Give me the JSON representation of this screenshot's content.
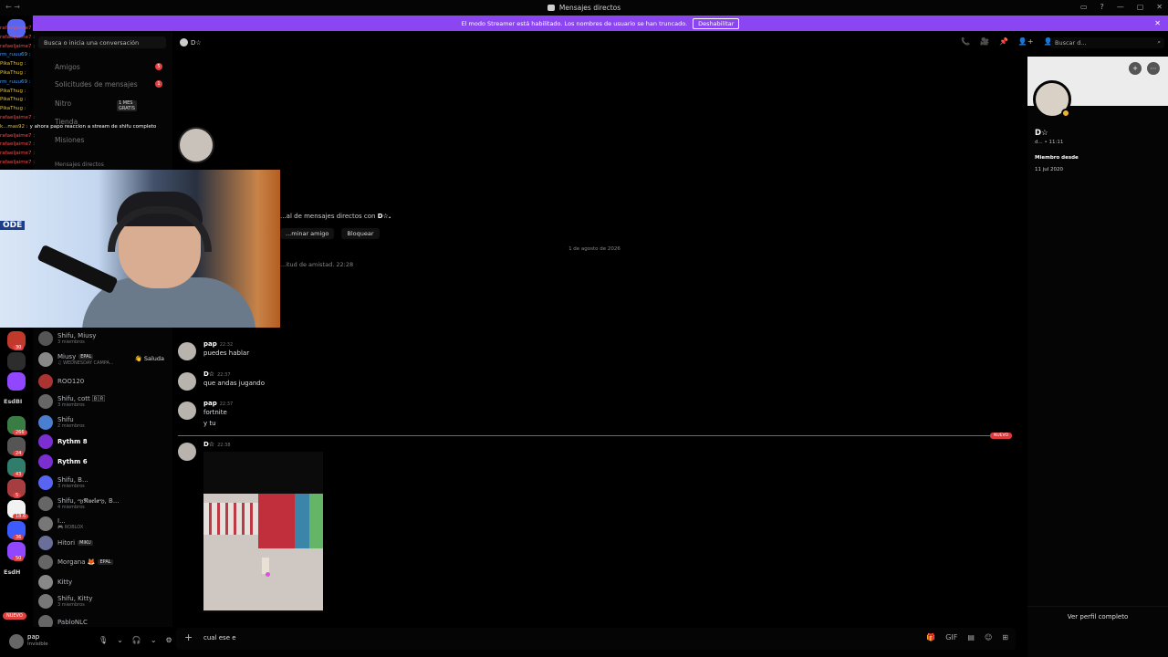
{
  "titlebar": {
    "title": "Mensajes directos",
    "nav": "← →",
    "controls": [
      "▭",
      "?",
      "—",
      "▢",
      "✕"
    ]
  },
  "banner": {
    "text": "El modo Streamer está habilitado. Los nombres de usuario se han truncado.",
    "button": "Deshabilitar",
    "close": "✕"
  },
  "rail": {
    "items": [
      {
        "label": "",
        "color": "#5865f2",
        "badge": ""
      },
      {
        "label": "",
        "color": "#c0392b",
        "badge": "30"
      },
      {
        "label": "",
        "color": "#2d2d2d",
        "badge": ""
      },
      {
        "label": "",
        "color": "#9146ff",
        "badge": ""
      },
      {
        "label": "EsdBI",
        "color": "",
        "badge": ""
      },
      {
        "label": "",
        "color": "#3a7d44",
        "badge": "266"
      },
      {
        "label": "",
        "color": "#555",
        "badge": "24"
      },
      {
        "label": "",
        "color": "#2f7d6a",
        "badge": "43"
      },
      {
        "label": "",
        "color": "#a63d40",
        "badge": "5"
      },
      {
        "label": "",
        "color": "#f2f2f2",
        "badge": "18.6"
      },
      {
        "label": "",
        "color": "#3d5afe",
        "badge": "36"
      },
      {
        "label": "",
        "color": "#9146ff",
        "badge": "50"
      },
      {
        "label": "EsdH",
        "color": "",
        "badge": ""
      }
    ],
    "nuevo": "NUEVO"
  },
  "dm_sidebar": {
    "search_placeholder": "Busca o inicia una conversación",
    "nav": [
      {
        "label": "Amigos",
        "badge": "5"
      },
      {
        "label": "Solicitudes de mensajes",
        "badge": "1"
      },
      {
        "label": "Nitro",
        "badge": "1 MES GRATIS"
      },
      {
        "label": "Tienda",
        "badge": ""
      },
      {
        "label": "Misiones",
        "badge": ""
      }
    ],
    "section": "Mensajes directos",
    "rows": [
      {
        "name": "Shifu, Miusy",
        "sub": "3 miembros",
        "color": "#555",
        "bold": false,
        "tag": ""
      },
      {
        "name": "Miusy",
        "sub": "♫ WEDNESDAY CAMPA...",
        "color": "#888",
        "bold": false,
        "tag": "EPAL"
      },
      {
        "name": "ROO120",
        "sub": "",
        "color": "#a33",
        "bold": false,
        "tag": ""
      },
      {
        "name": "Shifu, cott 🄱🅁",
        "sub": "3 miembros",
        "color": "#666",
        "bold": false,
        "tag": ""
      },
      {
        "name": "Shifu",
        "sub": "2 miembros",
        "color": "#4a7fd0",
        "bold": false,
        "tag": ""
      },
      {
        "name": "Rythm 8",
        "sub": "",
        "color": "#7b2fd0",
        "bold": true,
        "tag": ""
      },
      {
        "name": "Rythm 6",
        "sub": "",
        "color": "#7b2fd0",
        "bold": true,
        "tag": ""
      },
      {
        "name": "Shifu, B...",
        "sub": "3 miembros",
        "color": "#5865f2",
        "bold": false,
        "tag": ""
      },
      {
        "name": "Shifu, ఌ𝕽𝖚𝖊𝖑𝖆ఌ, B...",
        "sub": "4 miembros",
        "color": "#666",
        "bold": false,
        "tag": ""
      },
      {
        "name": "I...",
        "sub": "🎮 ROBLOX",
        "color": "#777",
        "bold": false,
        "tag": ""
      },
      {
        "name": "Hitori",
        "sub": "",
        "color": "#6a6f9a",
        "bold": false,
        "tag": "MIKU"
      },
      {
        "name": "Morgana 🦊",
        "sub": "",
        "color": "#666",
        "bold": false,
        "tag": "EPAL"
      },
      {
        "name": "Kitty",
        "sub": "",
        "color": "#888",
        "bold": false,
        "tag": ""
      },
      {
        "name": "Shifu, Kitty",
        "sub": "3 miembros",
        "color": "#777",
        "bold": false,
        "tag": ""
      },
      {
        "name": "PabloNLC",
        "sub": "",
        "color": "#666",
        "bold": false,
        "tag": ""
      }
    ],
    "saluda": "👋 Saluda"
  },
  "user": {
    "name": "pap",
    "status": "Invisible",
    "controls": [
      "🎙",
      "⌄",
      "🎧",
      "⌄",
      "⚙"
    ]
  },
  "chat": {
    "header_name": "D☆",
    "header_icons": [
      "📞",
      "🎥",
      "📌",
      "👤+",
      "👤"
    ],
    "search_placeholder": "Buscar d...",
    "welcome_prefix": "...al de mensajes directos con ",
    "welcome_name": "D☆.",
    "welcome_buttons": [
      "...minar amigo",
      "Bloquear"
    ],
    "date_separator": "1 de agosto de 2026",
    "system": "...itud de amistad. 22:28",
    "messages": [
      {
        "author": "pap",
        "time": "22:32",
        "lines": [
          "puedes hablar"
        ]
      },
      {
        "author": "D☆",
        "time": "22:37",
        "lines": [
          "que andas jugando"
        ]
      },
      {
        "author": "pap",
        "time": "22:37",
        "lines": [
          "fortnite",
          "y tu"
        ]
      },
      {
        "author": "D☆",
        "time": "22:38",
        "lines": []
      }
    ],
    "new_badge": "NUEVO",
    "composer_text": "cual ese e",
    "composer_tools": [
      "🎁",
      "GIF",
      "▤",
      "☺",
      "⊞"
    ]
  },
  "profile": {
    "name": "D☆",
    "handle": "d... • 11:11",
    "member_label": "Miembro desde",
    "member_date": "11 jul 2020",
    "full_profile": "Ver perfil completo"
  },
  "stream_chat": [
    {
      "user": "rafaeljaime7 :",
      "text": "",
      "color": "n3"
    },
    {
      "user": "rafaeljaime7 :",
      "text": "",
      "color": "n3"
    },
    {
      "user": "rafaeljaime7 :",
      "text": "",
      "color": "n3"
    },
    {
      "user": "rm_ruuu69 :",
      "text": "",
      "color": "n1"
    },
    {
      "user": "PikaThug :",
      "text": "",
      "color": "n2"
    },
    {
      "user": "PikaThug :",
      "text": "",
      "color": "n2"
    },
    {
      "user": "rm_ruuu69 :",
      "text": "",
      "color": "n1"
    },
    {
      "user": "PikaThug :",
      "text": "",
      "color": "n2"
    },
    {
      "user": "PikaThug :",
      "text": "",
      "color": "n2"
    },
    {
      "user": "PikaThug :",
      "text": "",
      "color": "n2"
    },
    {
      "user": "rafaeljaime7 :",
      "text": "",
      "color": "n3"
    },
    {
      "user": "k...mas92 :",
      "text": "y ahora papo reaccion a stream de shifu completo",
      "color": "n2"
    },
    {
      "user": "rafaeljaime7 :",
      "text": "",
      "color": "n3"
    },
    {
      "user": "rafaeljaime7 :",
      "text": "",
      "color": "n3"
    },
    {
      "user": "rafaeljaime7 :",
      "text": "",
      "color": "n3"
    },
    {
      "user": "rafaeljaime7 :",
      "text": "",
      "color": "n3"
    }
  ],
  "webcam": {
    "sign": "ODE"
  }
}
